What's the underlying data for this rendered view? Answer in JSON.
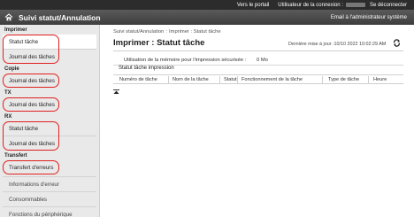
{
  "topbar": {
    "portal_link": "Vers le portail",
    "user_label": "Utilisateur de la connexion :",
    "logout_link": "Se déconnecter"
  },
  "titlebar": {
    "title": "Suivi statut/Annulation",
    "admin_email": "Email à l'administrateur système"
  },
  "sidebar": {
    "imprimer": {
      "heading": "Imprimer",
      "items": [
        "Statut tâche",
        "Journal des tâches"
      ]
    },
    "copie": {
      "heading": "Copie",
      "items": [
        "Journal des tâches"
      ]
    },
    "tx": {
      "heading": "TX",
      "items": [
        "Journal des tâches"
      ]
    },
    "rx": {
      "heading": "RX",
      "items": [
        "Statut tâche",
        "Journal des tâches"
      ]
    },
    "transfert": {
      "heading": "Transfert",
      "items": [
        "Transfert d'erreurs"
      ]
    },
    "extra": [
      "Informations d'erreur",
      "Consommables",
      "Fonctions du périphérique"
    ]
  },
  "main": {
    "breadcrumb": [
      "Suivi statut/Annulation",
      "Imprimer : Statut tâche"
    ],
    "breadcrumb_sep": ":",
    "title": "Imprimer : Statut tâche",
    "last_update": "Dernière mise à jour :10/10 2022 10:02:29 AM",
    "memory_label": "Utilisation de la mémoire pour l'impression sécurisée :",
    "memory_value": "0 Mo",
    "section_title": "Statut tâche impression",
    "columns": [
      "Numéro de tâche",
      "Nom de la tâche",
      "Statut",
      "Fonctionnement de la tâche",
      "Type de tâche",
      "Heure"
    ]
  },
  "colors": {
    "topbar": "#2c2c2c",
    "titlebar": "#4a4a4a",
    "sidebar": "#e9e9e9",
    "highlight": "#e02020"
  }
}
